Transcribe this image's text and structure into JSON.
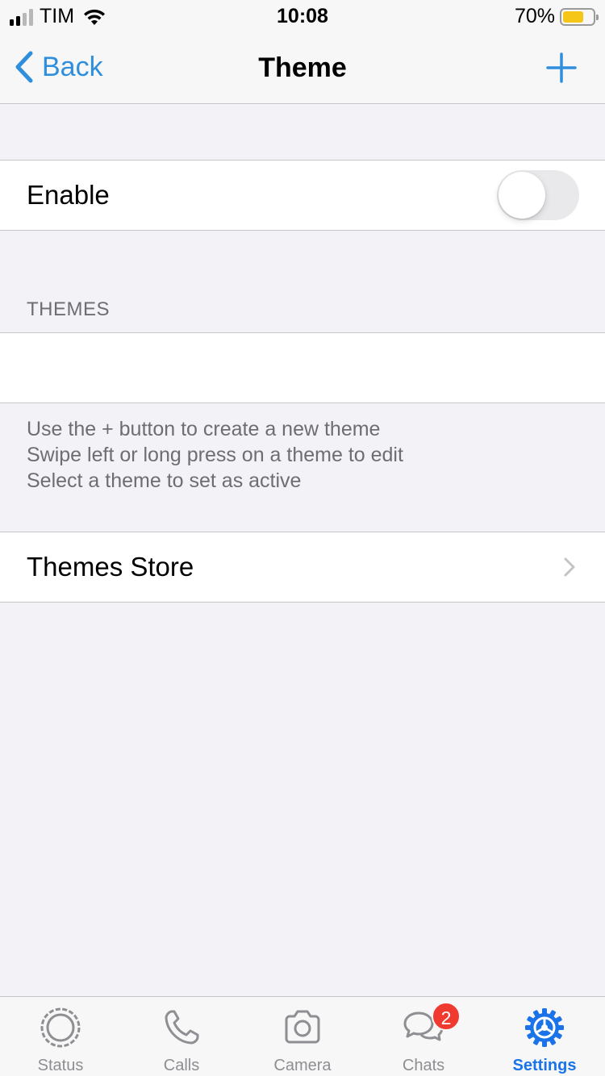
{
  "status_bar": {
    "carrier": "TIM",
    "time": "10:08",
    "battery_percent": "70%",
    "battery_level": 0.7,
    "battery_color": "#f5c518",
    "signal_bars_active": 2,
    "signal_bars_total": 4
  },
  "nav": {
    "back_label": "Back",
    "title": "Theme",
    "add_icon": "plus-icon",
    "accent_color": "#2f8fdd"
  },
  "enable": {
    "label": "Enable",
    "toggle_on": false
  },
  "themes": {
    "header": "THEMES",
    "items": [],
    "footer": [
      "Use the + button to create a new theme",
      "Swipe left or long press on a theme to edit",
      "Select a theme to set as active"
    ]
  },
  "store": {
    "label": "Themes Store",
    "icon": "chevron-right-icon"
  },
  "tabbar": {
    "active_color": "#1a73e8",
    "badge_color": "#f03a2f",
    "tabs": [
      {
        "label": "Status",
        "icon": "status-icon",
        "active": false
      },
      {
        "label": "Calls",
        "icon": "phone-icon",
        "active": false
      },
      {
        "label": "Camera",
        "icon": "camera-icon",
        "active": false
      },
      {
        "label": "Chats",
        "icon": "chats-icon",
        "active": false,
        "badge": "2"
      },
      {
        "label": "Settings",
        "icon": "gear-icon",
        "active": true
      }
    ]
  }
}
